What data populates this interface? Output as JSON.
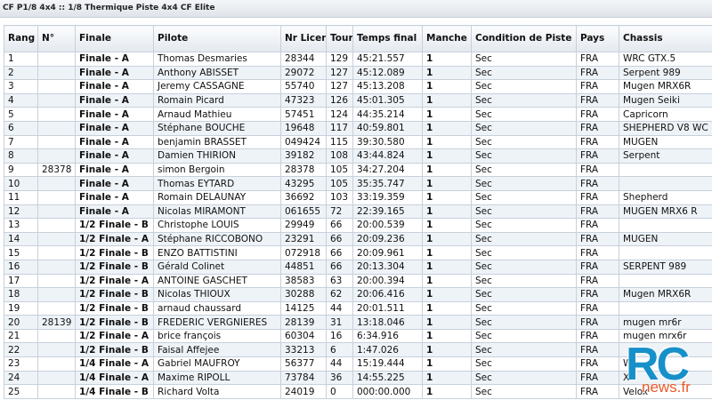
{
  "page": {
    "title": "CF P1/8 4x4 :: 1/8 Thermique Piste 4x4 CF Elite"
  },
  "table": {
    "headers": [
      "Rang",
      "N°",
      "Finale",
      "Pilote",
      "Nr Licence",
      "Tour",
      "Temps final",
      "Manche",
      "Condition de Piste",
      "Pays",
      "Chassis"
    ],
    "rows": [
      [
        "1",
        "",
        "Finale - A",
        "Thomas Desmaries",
        "28344",
        "129",
        "45:21.557",
        "1",
        "Sec",
        "FRA",
        "WRC GTX.5"
      ],
      [
        "2",
        "",
        "Finale - A",
        "Anthony ABISSET",
        "29072",
        "127",
        "45:12.089",
        "1",
        "Sec",
        "FRA",
        "Serpent 989"
      ],
      [
        "3",
        "",
        "Finale - A",
        "Jeremy CASSAGNE",
        "55740",
        "127",
        "45:13.208",
        "1",
        "Sec",
        "FRA",
        "Mugen MRX6R"
      ],
      [
        "4",
        "",
        "Finale - A",
        "Romain Picard",
        "47323",
        "126",
        "45:01.305",
        "1",
        "Sec",
        "FRA",
        "Mugen Seiki"
      ],
      [
        "5",
        "",
        "Finale - A",
        "Arnaud Mathieu",
        "57451",
        "124",
        "44:35.214",
        "1",
        "Sec",
        "FRA",
        "Capricorn"
      ],
      [
        "6",
        "",
        "Finale - A",
        "Stéphane BOUCHE",
        "19648",
        "117",
        "40:59.801",
        "1",
        "Sec",
        "FRA",
        "SHEPHERD V8 WC"
      ],
      [
        "7",
        "",
        "Finale - A",
        "benjamin BRASSET",
        "049424",
        "115",
        "39:30.580",
        "1",
        "Sec",
        "FRA",
        "MUGEN"
      ],
      [
        "8",
        "",
        "Finale - A",
        "Damien THIRION",
        "39182",
        "108",
        "43:44.824",
        "1",
        "Sec",
        "FRA",
        "Serpent"
      ],
      [
        "9",
        "28378",
        "Finale - A",
        "simon Bergoin",
        "28378",
        "105",
        "34:27.204",
        "1",
        "Sec",
        "FRA",
        ""
      ],
      [
        "10",
        "",
        "Finale - A",
        "Thomas EYTARD",
        "43295",
        "105",
        "35:35.747",
        "1",
        "Sec",
        "FRA",
        ""
      ],
      [
        "11",
        "",
        "Finale - A",
        "Romain DELAUNAY",
        "36692",
        "103",
        "33:19.359",
        "1",
        "Sec",
        "FRA",
        "Shepherd"
      ],
      [
        "12",
        "",
        "Finale - A",
        "Nicolas MIRAMONT",
        "061655",
        "72",
        "22:39.165",
        "1",
        "Sec",
        "FRA",
        "MUGEN MRX6 R"
      ],
      [
        "13",
        "",
        "1/2 Finale - B",
        "Christophe LOUIS",
        "29949",
        "66",
        "20:00.539",
        "1",
        "Sec",
        "FRA",
        ""
      ],
      [
        "14",
        "",
        "1/2 Finale - A",
        "Stéphane RICCOBONO",
        "23291",
        "66",
        "20:09.236",
        "1",
        "Sec",
        "FRA",
        "MUGEN"
      ],
      [
        "15",
        "",
        "1/2 Finale - B",
        "ENZO BATTISTINI",
        "072918",
        "66",
        "20:09.961",
        "1",
        "Sec",
        "FRA",
        ""
      ],
      [
        "16",
        "",
        "1/2 Finale - B",
        "Gérald Colinet",
        "44851",
        "66",
        "20:13.304",
        "1",
        "Sec",
        "FRA",
        "SERPENT 989"
      ],
      [
        "17",
        "",
        "1/2 Finale - A",
        "ANTOINE GASCHET",
        "38583",
        "63",
        "20:00.394",
        "1",
        "Sec",
        "FRA",
        ""
      ],
      [
        "18",
        "",
        "1/2 Finale - B",
        "Nicolas THIOUX",
        "30288",
        "62",
        "20:06.416",
        "1",
        "Sec",
        "FRA",
        "Mugen MRX6R"
      ],
      [
        "19",
        "",
        "1/2 Finale - B",
        "arnaud chaussard",
        "14125",
        "44",
        "20:01.511",
        "1",
        "Sec",
        "FRA",
        ""
      ],
      [
        "20",
        "28139",
        "1/2 Finale - B",
        "FREDERIC VERGNIERES",
        "28139",
        "31",
        "13:18.046",
        "1",
        "Sec",
        "FRA",
        "mugen mr6r"
      ],
      [
        "21",
        "",
        "1/2 Finale - A",
        "brice françois",
        "60304",
        "16",
        "6:34.916",
        "1",
        "Sec",
        "FRA",
        "mugen mrx6r"
      ],
      [
        "22",
        "",
        "1/2 Finale - B",
        "Faisal Affejee",
        "33213",
        "6",
        "1:47.026",
        "1",
        "Sec",
        "FRA",
        ""
      ],
      [
        "23",
        "",
        "1/4 Finale - A",
        "Gabriel MAUFROY",
        "56377",
        "44",
        "15:19.444",
        "1",
        "Sec",
        "FRA",
        "W"
      ],
      [
        "24",
        "",
        "1/4 Finale - A",
        "Maxime RIPOLL",
        "73784",
        "36",
        "14:55.225",
        "1",
        "Sec",
        "FRA",
        "XR"
      ],
      [
        "25",
        "",
        "1/4 Finale - B",
        "Richard Volta",
        "24019",
        "0",
        "000:00.000",
        "1",
        "Sec",
        "FRA",
        "Velox"
      ]
    ]
  },
  "logo": {
    "main": "RC",
    "sub": "news.fr",
    "color_main": "#1790c9",
    "color_sub": "#e9582a"
  }
}
